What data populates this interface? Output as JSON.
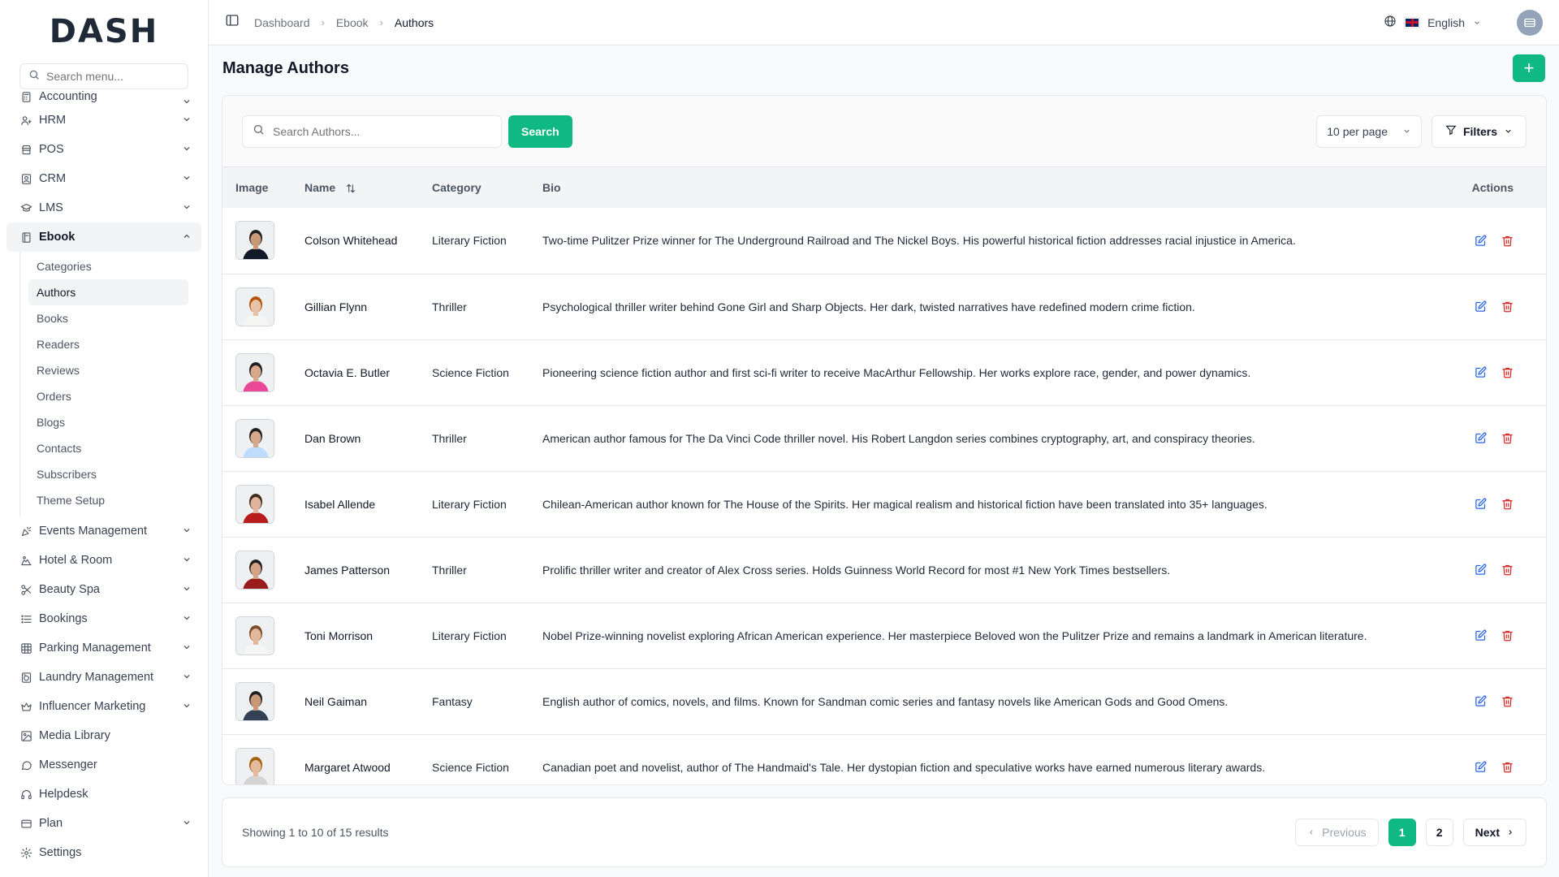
{
  "brand": {
    "logo_text": "DASH"
  },
  "sidebar": {
    "search_placeholder": "Search menu...",
    "items": [
      {
        "label": "Accounting",
        "icon": "calculator-icon",
        "chevron": true
      },
      {
        "label": "HRM",
        "icon": "users-icon",
        "chevron": true
      },
      {
        "label": "POS",
        "icon": "store-icon",
        "chevron": true
      },
      {
        "label": "CRM",
        "icon": "contact-icon",
        "chevron": true
      },
      {
        "label": "LMS",
        "icon": "graduation-icon",
        "chevron": true
      },
      {
        "label": "Ebook",
        "icon": "book-icon",
        "chevron": true,
        "expanded": true
      }
    ],
    "ebook_sub": [
      "Categories",
      "Authors",
      "Books",
      "Readers",
      "Reviews",
      "Orders",
      "Blogs",
      "Contacts",
      "Subscribers",
      "Theme Setup"
    ],
    "items_after": [
      {
        "label": "Events Management",
        "icon": "party-icon",
        "chevron": true
      },
      {
        "label": "Hotel & Room",
        "icon": "hotel-icon",
        "chevron": true
      },
      {
        "label": "Beauty Spa",
        "icon": "scissors-icon",
        "chevron": true
      },
      {
        "label": "Bookings",
        "icon": "list-icon",
        "chevron": true
      },
      {
        "label": "Parking Management",
        "icon": "grid-icon",
        "chevron": true
      },
      {
        "label": "Laundry Management",
        "icon": "washer-icon",
        "chevron": true
      },
      {
        "label": "Influencer Marketing",
        "icon": "crown-icon",
        "chevron": true
      },
      {
        "label": "Media Library",
        "icon": "image-icon",
        "chevron": false
      },
      {
        "label": "Messenger",
        "icon": "chat-icon",
        "chevron": false
      },
      {
        "label": "Helpdesk",
        "icon": "headset-icon",
        "chevron": false
      },
      {
        "label": "Plan",
        "icon": "card-icon",
        "chevron": true
      },
      {
        "label": "Settings",
        "icon": "gear-icon",
        "chevron": false
      }
    ]
  },
  "topbar": {
    "breadcrumb": [
      "Dashboard",
      "Ebook",
      "Authors"
    ],
    "language": "English"
  },
  "page": {
    "title": "Manage Authors",
    "add_label": "+"
  },
  "toolbar": {
    "search_placeholder": "Search Authors...",
    "search_button": "Search",
    "per_page": "10 per page",
    "filters": "Filters"
  },
  "table": {
    "headers": {
      "image": "Image",
      "name": "Name",
      "category": "Category",
      "bio": "Bio",
      "actions": "Actions"
    },
    "rows": [
      {
        "name": "Colson Whitehead",
        "category": "Literary Fiction",
        "bio": "Two-time Pulitzer Prize winner for The Underground Railroad and The Nickel Boys. His powerful historical fiction addresses racial injustice in America.",
        "skin": "#c89a7a",
        "shirt": "#111827",
        "hair": "#1f1f1f"
      },
      {
        "name": "Gillian Flynn",
        "category": "Thriller",
        "bio": "Psychological thriller writer behind Gone Girl and Sharp Objects. Her dark, twisted narratives have redefined modern crime fiction.",
        "skin": "#e8c2a6",
        "shirt": "#f5f5f4",
        "hair": "#b45309"
      },
      {
        "name": "Octavia E. Butler",
        "category": "Science Fiction",
        "bio": "Pioneering science fiction author and first sci-fi writer to receive MacArthur Fellowship. Her works explore race, gender, and power dynamics.",
        "skin": "#d9a88a",
        "shirt": "#ec4899",
        "hair": "#1f1f1f"
      },
      {
        "name": "Dan Brown",
        "category": "Thriller",
        "bio": "American author famous for The Da Vinci Code thriller novel. His Robert Langdon series combines cryptography, art, and conspiracy theories.",
        "skin": "#d6a98c",
        "shirt": "#bfdbfe",
        "hair": "#1f1f1f"
      },
      {
        "name": "Isabel Allende",
        "category": "Literary Fiction",
        "bio": "Chilean-American author known for The House of the Spirits. Her magical realism and historical fiction have been translated into 35+ languages.",
        "skin": "#e0b49a",
        "shirt": "#b91c1c",
        "hair": "#3f2a1e"
      },
      {
        "name": "James Patterson",
        "category": "Thriller",
        "bio": "Prolific thriller writer and creator of Alex Cross series. Holds Guinness World Record for most #1 New York Times bestsellers.",
        "skin": "#d4a385",
        "shirt": "#991b1b",
        "hair": "#1f1f1f"
      },
      {
        "name": "Toni Morrison",
        "category": "Literary Fiction",
        "bio": "Nobel Prize-winning novelist exploring African American experience. Her masterpiece Beloved won the Pulitzer Prize and remains a landmark in American literature.",
        "skin": "#e3b89c",
        "shirt": "#f5f5f4",
        "hair": "#7c4a2d"
      },
      {
        "name": "Neil Gaiman",
        "category": "Fantasy",
        "bio": "English author of comics, novels, and films. Known for Sandman comic series and fantasy novels like American Gods and Good Omens.",
        "skin": "#c99878",
        "shirt": "#334155",
        "hair": "#1f1f1f"
      },
      {
        "name": "Margaret Atwood",
        "category": "Science Fiction",
        "bio": "Canadian poet and novelist, author of The Handmaid's Tale. Her dystopian fiction and speculative works have earned numerous literary awards.",
        "skin": "#e4b99c",
        "shirt": "#d6d3d1",
        "hair": "#a16207"
      }
    ]
  },
  "pagination": {
    "showing": "Showing 1 to 10 of 15 results",
    "previous": "Previous",
    "pages": [
      "1",
      "2"
    ],
    "current": "1",
    "next": "Next"
  },
  "colors": {
    "accent": "#10b981",
    "edit": "#2563eb",
    "delete": "#dc2626"
  }
}
